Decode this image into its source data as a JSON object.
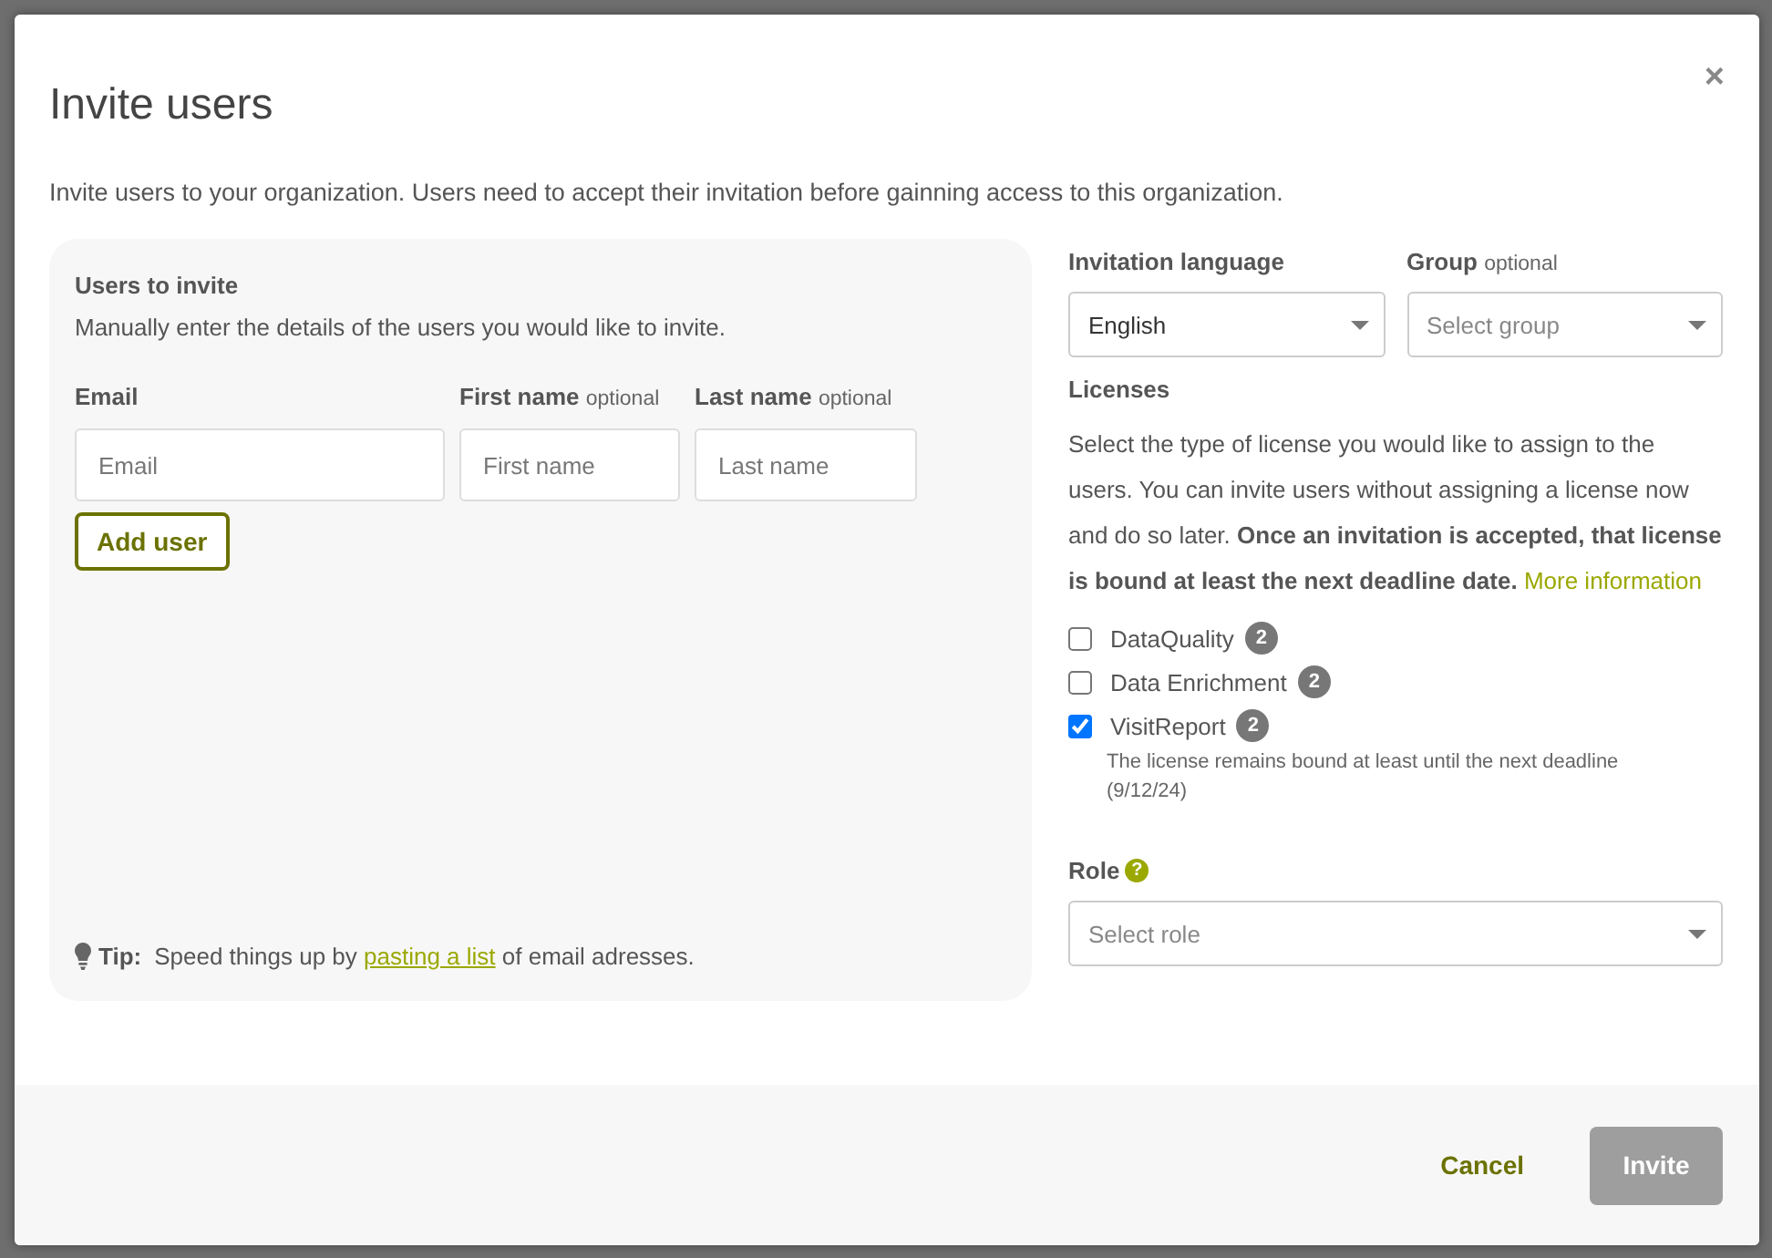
{
  "dialog": {
    "title": "Invite users",
    "close": "×",
    "description": "Invite users to your organization. Users need to accept their invitation before gainning access to this organization."
  },
  "users_panel": {
    "heading": "Users to invite",
    "hint": "Manually enter the details of the users you would like to invite.",
    "fields": [
      {
        "label": "Email",
        "placeholder": "Email"
      },
      {
        "label": "First name",
        "optional": "optional",
        "placeholder": "First name"
      },
      {
        "label": "Last name",
        "optional": "optional",
        "placeholder": "Last name"
      }
    ],
    "add_button": "Add user",
    "tip": {
      "label": "Tip:",
      "before": "Speed things up by",
      "link": "pasting a list",
      "after": "of email adresses."
    }
  },
  "invitation_language": {
    "label": "Invitation language",
    "value": "English"
  },
  "group": {
    "label": "Group",
    "optional": "optional",
    "placeholder": "Select group"
  },
  "licenses": {
    "heading": "Licenses",
    "text": "Select the type of license you would like to assign to the users. You can invite users without assigning a license now and do so later. **Once an invitation is accepted, that license is bound at least the next deadline date.**",
    "link": "More information",
    "items": [
      {
        "label": "DataQuality",
        "count": "2",
        "checked": false
      },
      {
        "label": "Data Enrichment",
        "count": "2",
        "checked": false
      },
      {
        "label": "VisitReport",
        "count": "2",
        "checked": true,
        "note": "The license remains bound at least until the next deadline (9/12/24)"
      }
    ]
  },
  "role": {
    "label": "Role",
    "help": "?",
    "placeholder": "Select role"
  },
  "footer": {
    "cancel": "Cancel",
    "invite": {
      "label": "Invite",
      "disabled": true
    }
  }
}
